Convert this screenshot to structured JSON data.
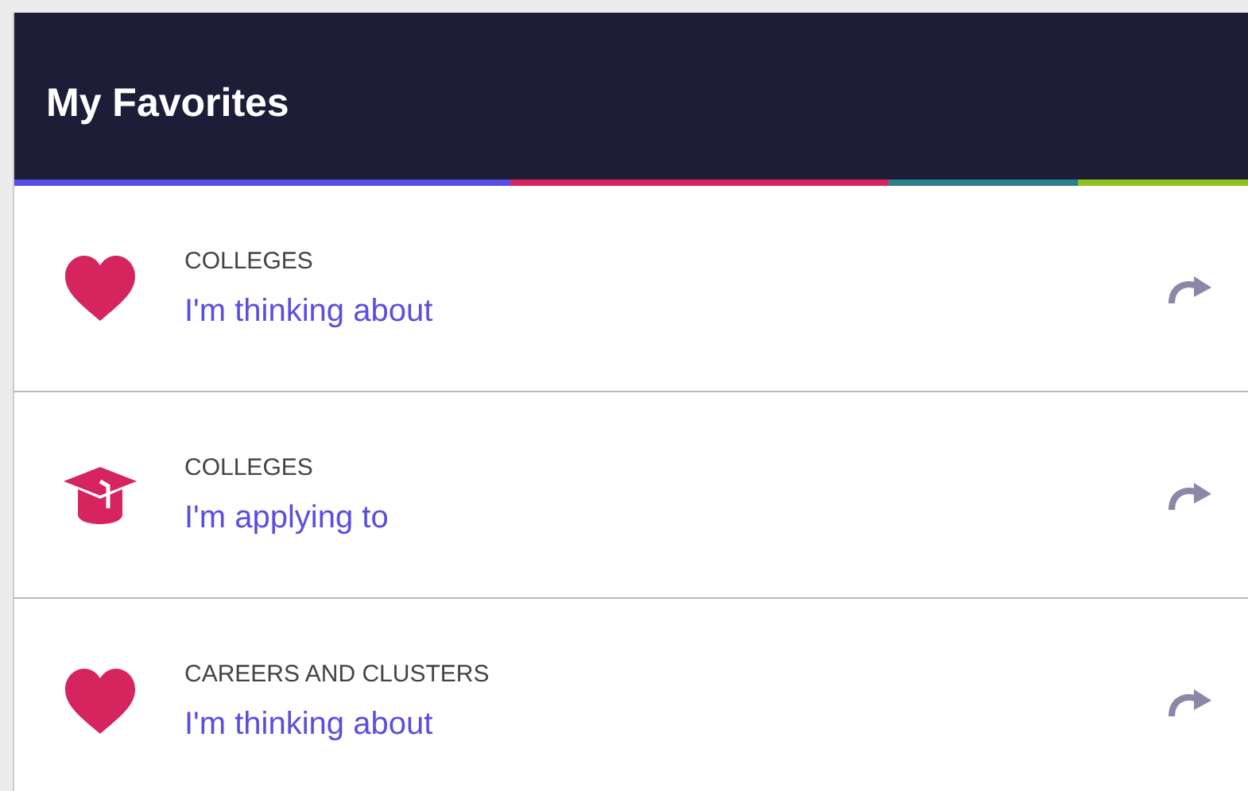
{
  "header": {
    "title": "My Favorites"
  },
  "lists": [
    {
      "kind": "heart",
      "category": "COLLEGES",
      "label": "I'm thinking about"
    },
    {
      "kind": "cap",
      "category": "COLLEGES",
      "label": "I'm applying to"
    },
    {
      "kind": "heart",
      "category": "CAREERS AND CLUSTERS",
      "label": "I'm thinking about"
    }
  ]
}
